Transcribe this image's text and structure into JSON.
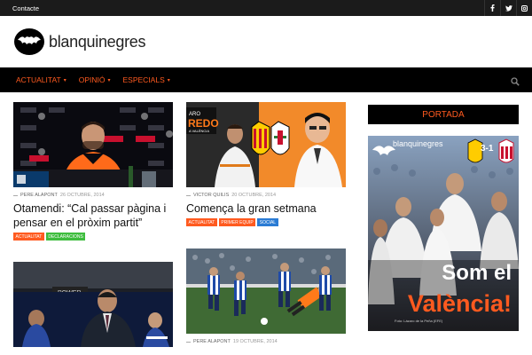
{
  "topbar": {
    "contact_label": "Contacte",
    "social_icons": [
      "facebook-icon",
      "twitter-icon",
      "instagram-icon"
    ]
  },
  "header": {
    "logo_text": "blanquinegres"
  },
  "nav": {
    "items": [
      {
        "label": "ACTUALITAT"
      },
      {
        "label": "OPINIÓ"
      },
      {
        "label": "ESPECIALS"
      }
    ],
    "accent": "#ff5a1f"
  },
  "articles": [
    {
      "author": "PERE ALAPONT",
      "date": "26 OCTUBRE, 2014",
      "title": "Otamendi: “Cal passar pàgina i pensar en el pròxim partit”",
      "tags": [
        {
          "label": "ACTUALITAT",
          "color": "#ff5a1f"
        },
        {
          "label": "DECLARACIONS",
          "color": "#3ebd3e"
        }
      ]
    },
    {
      "author": "VICTOR QUILIS",
      "date": "20 OCTUBRE, 2014",
      "title": "Comença la gran setmana",
      "tags": [
        {
          "label": "ACTUALITAT",
          "color": "#ff5a1f"
        },
        {
          "label": "PRIMER EQUIP",
          "color": "#ff5a1f"
        },
        {
          "label": "SOCIAL",
          "color": "#2a7bd4"
        }
      ]
    },
    {
      "author": "",
      "date": "",
      "title": "",
      "tags": []
    },
    {
      "author": "PERE ALAPONT",
      "date": "19 OCTUBRE, 2014",
      "title": "",
      "tags": []
    }
  ],
  "sidebar": {
    "portada_label": "PORTADA",
    "cover_logo": "blanquinegres",
    "cover_score": "3-1",
    "cover_headline_1": "Som el",
    "cover_headline_2": "València!"
  }
}
